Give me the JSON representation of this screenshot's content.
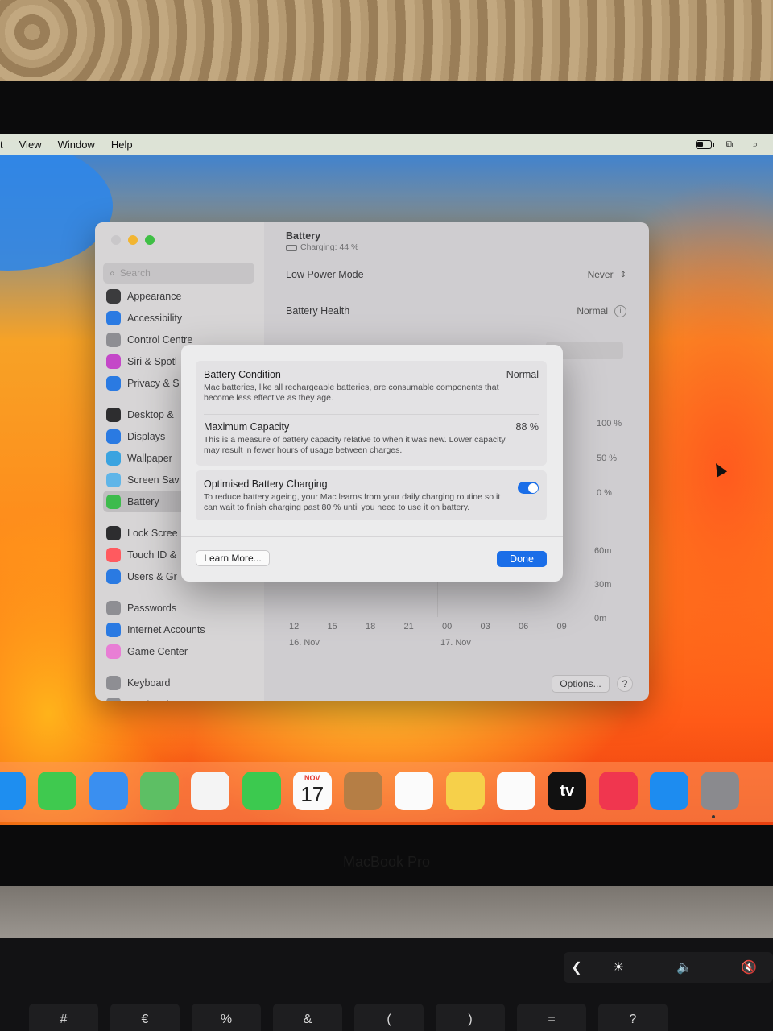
{
  "menubar": {
    "items": [
      "t",
      "View",
      "Window",
      "Help"
    ]
  },
  "sidebar": {
    "search_placeholder": "Search",
    "groups": [
      [
        {
          "label": "Appearance",
          "icon": "appearance-icon",
          "color": "#3b3b3d"
        },
        {
          "label": "Accessibility",
          "icon": "accessibility-icon",
          "color": "#2a7ae2"
        },
        {
          "label": "Control Centre",
          "icon": "control-centre-icon",
          "color": "#8e8e93"
        },
        {
          "label": "Siri & Spotl",
          "icon": "siri-icon",
          "color": "#c447c8"
        },
        {
          "label": "Privacy & S",
          "icon": "privacy-hand-icon",
          "color": "#2a7ae2"
        }
      ],
      [
        {
          "label": "Desktop &",
          "icon": "desktop-icon",
          "color": "#2d2d2f"
        },
        {
          "label": "Displays",
          "icon": "displays-icon",
          "color": "#2a7ae2"
        },
        {
          "label": "Wallpaper",
          "icon": "wallpaper-icon",
          "color": "#3aa3e0"
        },
        {
          "label": "Screen Sav",
          "icon": "screensaver-icon",
          "color": "#5fb5e8"
        },
        {
          "label": "Battery",
          "icon": "battery-icon",
          "color": "#3dbb4c",
          "active": true
        }
      ],
      [
        {
          "label": "Lock Scree",
          "icon": "lock-icon",
          "color": "#2d2d2f"
        },
        {
          "label": "Touch ID &",
          "icon": "fingerprint-icon",
          "color": "#ff5a5f"
        },
        {
          "label": "Users & Gr",
          "icon": "users-icon",
          "color": "#2a7ae2"
        }
      ],
      [
        {
          "label": "Passwords",
          "icon": "key-icon",
          "color": "#8e8e93"
        },
        {
          "label": "Internet Accounts",
          "icon": "at-icon",
          "color": "#2a7ae2"
        },
        {
          "label": "Game Center",
          "icon": "game-center-icon",
          "color": "#e87ed5"
        }
      ],
      [
        {
          "label": "Keyboard",
          "icon": "keyboard-icon",
          "color": "#8e8e93"
        },
        {
          "label": "Trackpad",
          "icon": "trackpad-icon",
          "color": "#8e8e93"
        }
      ]
    ]
  },
  "content": {
    "title": "Battery",
    "subtitle": "Charging: 44 %",
    "low_power_label": "Low Power Mode",
    "low_power_value": "Never",
    "health_label": "Battery Health",
    "health_value": "Normal",
    "pct_labels": [
      "100 %",
      "50 %",
      "0 %"
    ],
    "time_labels": [
      "60m",
      "30m",
      "0m"
    ],
    "x_ticks": [
      "12",
      "15",
      "18",
      "21",
      "00",
      "03",
      "06",
      "09"
    ],
    "dates": [
      "16. Nov",
      "17. Nov"
    ],
    "options_label": "Options...",
    "help_label": "?"
  },
  "dialog": {
    "condition_title": "Battery Condition",
    "condition_value": "Normal",
    "condition_desc": "Mac batteries, like all rechargeable batteries, are consumable components that become less effective as they age.",
    "capacity_title": "Maximum Capacity",
    "capacity_value": "88 %",
    "capacity_desc": "This is a measure of battery capacity relative to when it was new. Lower capacity may result in fewer hours of usage between charges.",
    "optimised_title": "Optimised Battery Charging",
    "optimised_on": true,
    "optimised_desc": "To reduce battery ageing, your Mac learns from your daily charging routine so it can wait to finish charging past 80 % until you need to use it on battery.",
    "learn_more_label": "Learn More...",
    "done_label": "Done"
  },
  "dock": {
    "apps": [
      {
        "name": "safari-icon",
        "color": "#1e8ef0"
      },
      {
        "name": "messages-icon",
        "color": "#3fc94f"
      },
      {
        "name": "mail-icon",
        "color": "#3a8ff0"
      },
      {
        "name": "maps-icon",
        "color": "#5dbf64"
      },
      {
        "name": "photos-icon",
        "color": "#f4f4f4"
      },
      {
        "name": "facetime-icon",
        "color": "#3cc94f"
      },
      {
        "name": "calendar-icon",
        "color": "#fbfbfb",
        "month": "NOV",
        "day": "17"
      },
      {
        "name": "contacts-icon",
        "color": "#b57e45"
      },
      {
        "name": "reminders-icon",
        "color": "#fbfbfb"
      },
      {
        "name": "notes-icon",
        "color": "#f6d04a"
      },
      {
        "name": "freeform-icon",
        "color": "#fbfbfb"
      },
      {
        "name": "apple-tv-icon",
        "color": "#111111",
        "label": "tv"
      },
      {
        "name": "music-icon",
        "color": "#f0364f"
      },
      {
        "name": "app-store-icon",
        "color": "#1d8cf0"
      },
      {
        "name": "system-settings-icon",
        "color": "#8a8a8e"
      }
    ]
  },
  "laptop": {
    "brand": "MacBook Pro",
    "keys": [
      "#",
      "€",
      "%",
      "&",
      "(",
      ")",
      "=",
      "?"
    ]
  },
  "colors": {
    "accent": "#1a6ee8",
    "battery_green": "#3dbb4c"
  }
}
